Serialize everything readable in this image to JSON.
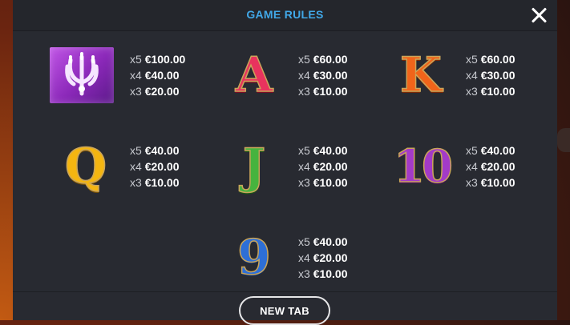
{
  "header": {
    "title": "GAME RULES",
    "close_icon": "close-icon"
  },
  "paytable": [
    {
      "symbol": "trident",
      "glyph": "",
      "rows": [
        {
          "mult": "x5",
          "amount": "€100.00"
        },
        {
          "mult": "x4",
          "amount": "€40.00"
        },
        {
          "mult": "x3",
          "amount": "€20.00"
        }
      ]
    },
    {
      "symbol": "A",
      "glyph": "A",
      "rows": [
        {
          "mult": "x5",
          "amount": "€60.00"
        },
        {
          "mult": "x4",
          "amount": "€30.00"
        },
        {
          "mult": "x3",
          "amount": "€10.00"
        }
      ]
    },
    {
      "symbol": "K",
      "glyph": "K",
      "rows": [
        {
          "mult": "x5",
          "amount": "€60.00"
        },
        {
          "mult": "x4",
          "amount": "€30.00"
        },
        {
          "mult": "x3",
          "amount": "€10.00"
        }
      ]
    },
    {
      "symbol": "Q",
      "glyph": "Q",
      "rows": [
        {
          "mult": "x5",
          "amount": "€40.00"
        },
        {
          "mult": "x4",
          "amount": "€20.00"
        },
        {
          "mult": "x3",
          "amount": "€10.00"
        }
      ]
    },
    {
      "symbol": "J",
      "glyph": "J",
      "rows": [
        {
          "mult": "x5",
          "amount": "€40.00"
        },
        {
          "mult": "x4",
          "amount": "€20.00"
        },
        {
          "mult": "x3",
          "amount": "€10.00"
        }
      ]
    },
    {
      "symbol": "10",
      "glyph": "10",
      "rows": [
        {
          "mult": "x5",
          "amount": "€40.00"
        },
        {
          "mult": "x4",
          "amount": "€20.00"
        },
        {
          "mult": "x3",
          "amount": "€10.00"
        }
      ]
    },
    {
      "symbol": "9",
      "glyph": "9",
      "rows": [
        {
          "mult": "x5",
          "amount": "€40.00"
        },
        {
          "mult": "x4",
          "amount": "€20.00"
        },
        {
          "mult": "x3",
          "amount": "€10.00"
        }
      ]
    }
  ],
  "footer": {
    "new_tab_label": "NEW TAB"
  },
  "colors": {
    "title": "#41a8e8",
    "panel": "#282a31",
    "header": "#24262c"
  }
}
